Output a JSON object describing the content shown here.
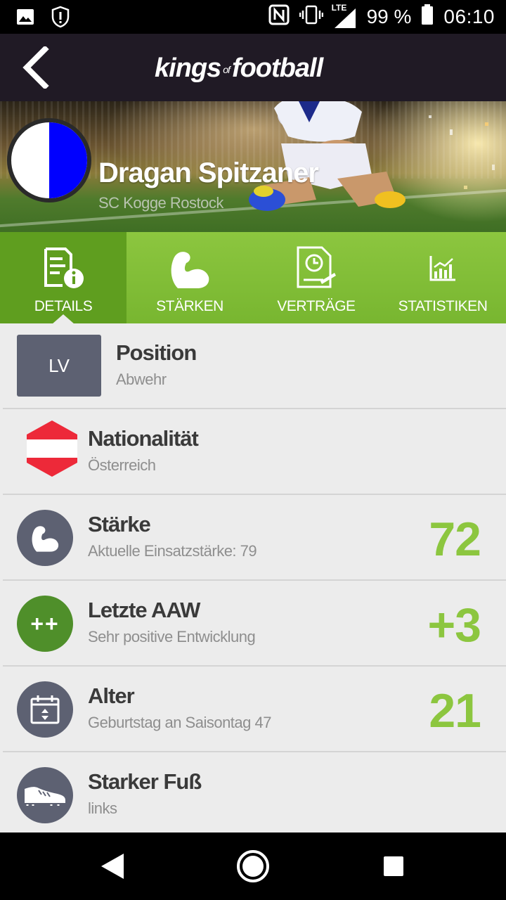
{
  "status_bar": {
    "battery_pct": "99 %",
    "time": "06:10",
    "network": "LTE"
  },
  "app_bar": {
    "logo_main_1": "kings",
    "logo_of": "of",
    "logo_main_2": "football"
  },
  "player": {
    "name": "Dragan Spitzaner",
    "club": "SC Kogge Rostock"
  },
  "tabs": [
    {
      "label": "DETAILS",
      "icon": "details-icon",
      "active": true
    },
    {
      "label": "STÄRKEN",
      "icon": "flexed-arm-icon",
      "active": false
    },
    {
      "label": "VERTRÄGE",
      "icon": "contract-icon",
      "active": false
    },
    {
      "label": "STATISTIKEN",
      "icon": "chart-icon",
      "active": false
    }
  ],
  "details": {
    "position": {
      "badge": "LV",
      "title": "Position",
      "subtitle": "Abwehr"
    },
    "nationality": {
      "title": "Nationalität",
      "subtitle": "Österreich"
    },
    "strength": {
      "title": "Stärke",
      "subtitle": "Aktuelle Einsatzstärke: 79",
      "value": "72"
    },
    "last_aaw": {
      "icon_text": "++",
      "title": "Letzte AAW",
      "subtitle": "Sehr positive Entwicklung",
      "value": "+3"
    },
    "age": {
      "title": "Alter",
      "subtitle": "Geburtstag an Saisontag 47",
      "value": "21"
    },
    "strong_foot": {
      "title": "Starker Fuß",
      "subtitle": "links"
    }
  },
  "colors": {
    "accent_green": "#8cc63f",
    "tab_active": "#5f9e1f",
    "app_bar": "#201a25",
    "icon_circle": "#5d6172",
    "austria_red": "#ed2939"
  }
}
